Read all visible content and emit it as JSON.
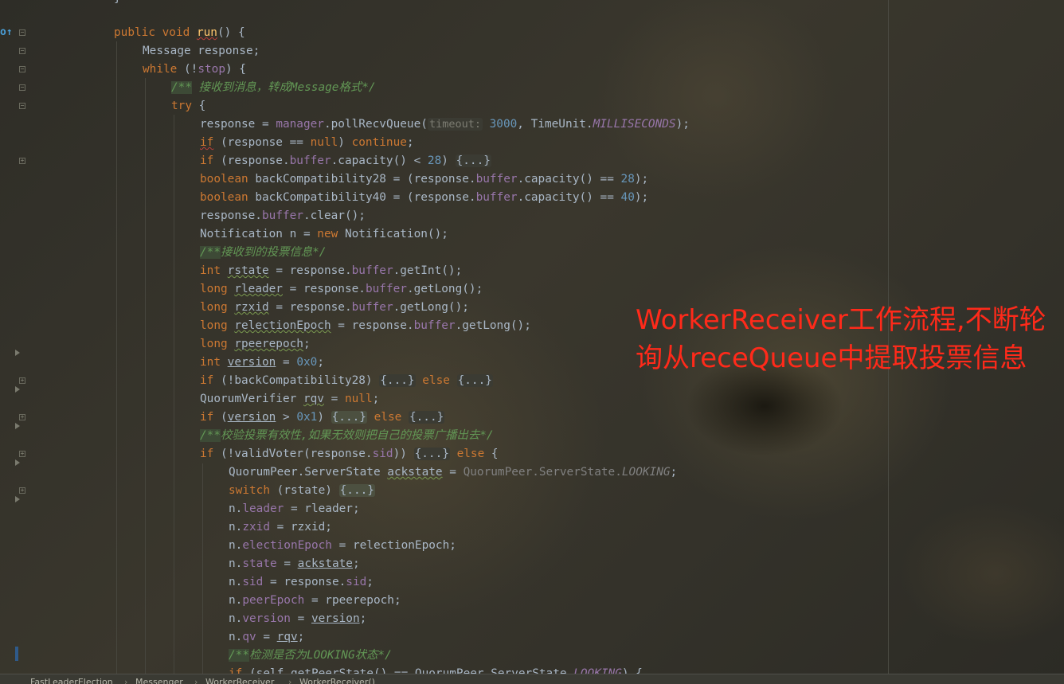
{
  "code": {
    "top_fragment": "}",
    "lines": {
      "l1": {
        "p1": "public void ",
        "p2": "run",
        "p3": "() {"
      },
      "l2": {
        "p1": "Message response;"
      },
      "l3": {
        "p1": "while",
        "p2": " (!",
        "p3": "stop",
        "p4": ") {"
      },
      "l4": {
        "p1": "/**",
        "p2": " 接收到消息，转成Message格式*/"
      },
      "l5": {
        "p1": "try",
        "p2": " {"
      },
      "l6": {
        "p1": "response = ",
        "p2": "manager",
        "p3": ".pollRecvQueue(",
        "hint": "timeout:",
        "p4": " 3000",
        "p5": ", TimeUnit.",
        "p6": "MILLISECONDS",
        "p7": ");"
      },
      "l7": {
        "p1": "if",
        "p2": " (response == ",
        "p3": "null",
        "p4": ") ",
        "p5": "continue",
        "p6": ";"
      },
      "l8": {
        "p1": "if",
        "p2": " (response.",
        "p3": "buffer",
        "p4": ".capacity() < ",
        "p5": "28",
        "p6": ") ",
        "fold": "{...}"
      },
      "l9": {
        "p1": "boolean",
        "p2": " backCompatibility28 = (response.",
        "p3": "buffer",
        "p4": ".capacity() == ",
        "p5": "28",
        "p6": ");"
      },
      "l10": {
        "p1": "boolean",
        "p2": " backCompatibility40 = (response.",
        "p3": "buffer",
        "p4": ".capacity() == ",
        "p5": "40",
        "p6": ");"
      },
      "l11": {
        "p1": "response.",
        "p2": "buffer",
        "p3": ".clear();"
      },
      "l12": {
        "p1": "Notification n = ",
        "p2": "new",
        "p3": " Notification();"
      },
      "l13": {
        "p1": "/**",
        "p2": "接收到的投票信息*/"
      },
      "l14": {
        "p1": "int",
        "p2": " ",
        "p3": "rstate",
        "p4": " = response.",
        "p5": "buffer",
        "p6": ".getInt();"
      },
      "l15": {
        "p1": "long",
        "p2": " ",
        "p3": "rleader",
        "p4": " = response.",
        "p5": "buffer",
        "p6": ".getLong();"
      },
      "l16": {
        "p1": "long",
        "p2": " ",
        "p3": "rzxid",
        "p4": " = response.",
        "p5": "buffer",
        "p6": ".getLong();"
      },
      "l17": {
        "p1": "long",
        "p2": " ",
        "p3": "relectionEpoch",
        "p4": " = response.",
        "p5": "buffer",
        "p6": ".getLong();"
      },
      "l18": {
        "p1": "long",
        "p2": " ",
        "p3": "rpeerepoch",
        "p4": ";"
      },
      "l19": {
        "p1": "int",
        "p2": " ",
        "p3": "version",
        "p4": " = ",
        "p5": "0x0",
        "p6": ";"
      },
      "l20": {
        "p1": "if",
        "p2": " (!backCompatibility28) ",
        "fold1": "{...}",
        "p3": " else ",
        "fold2": "{...}"
      },
      "l21": {
        "p1": "QuorumVerifier ",
        "p2": "rqv",
        "p3": " = ",
        "p4": "null",
        "p5": ";"
      },
      "l22": {
        "p1": "if",
        "p2": " (",
        "p3": "version",
        "p4": " > ",
        "p5": "0x1",
        "p6": ") ",
        "fold1": "{...}",
        "p7": " else ",
        "fold2": "{...}"
      },
      "l23": {
        "p1": "/**",
        "p2": "校验投票有效性,如果无效则把自己的投票广播出去*/"
      },
      "l24": {
        "p1": "if",
        "p2": " (!validVoter(response.",
        "p3": "sid",
        "p4": ")) ",
        "fold": "{...}",
        "p5": " else",
        "p6": " {"
      },
      "l25": {
        "p1": "QuorumPeer.ServerState ",
        "p2": "ackstate",
        "p3": " = ",
        "p4": "QuorumPeer.ServerState.",
        "p5": "LOOKING",
        "p6": ";"
      },
      "l26": {
        "p1": "switch",
        "p2": " (rstate) ",
        "fold": "{...}"
      },
      "l27": {
        "p1": "n.",
        "p2": "leader",
        "p3": " = rleader;"
      },
      "l28": {
        "p1": "n.",
        "p2": "zxid",
        "p3": " = rzxid;"
      },
      "l29": {
        "p1": "n.",
        "p2": "electionEpoch",
        "p3": " = relectionEpoch;"
      },
      "l30": {
        "p1": "n.",
        "p2": "state",
        "p3": " = ",
        "p4": "ackstate",
        "p5": ";"
      },
      "l31": {
        "p1": "n.",
        "p2": "sid",
        "p3": " = response.",
        "p4": "sid",
        "p5": ";"
      },
      "l32": {
        "p1": "n.",
        "p2": "peerEpoch",
        "p3": " = rpeerepoch;"
      },
      "l33": {
        "p1": "n.",
        "p2": "version",
        "p3": " = ",
        "p4": "version",
        "p5": ";"
      },
      "l34": {
        "p1": "n.",
        "p2": "qv",
        "p3": " = ",
        "p4": "rqv",
        "p5": ";"
      },
      "l35": {
        "p1": "/**",
        "p2": "检测是否为",
        "p3": "LOOKING",
        "p4": "状态*/"
      },
      "l36": {
        "p1": "if",
        "p2": " (self.getPeerState() == QuorumPeer.ServerState.",
        "p3": "LOOKING",
        "p4": ") {"
      }
    }
  },
  "annotation": {
    "line1": "WorkerReceiver工作流程,不断轮",
    "line2": "询从receQueue中提取投票信息"
  },
  "breadcrumb": [
    "FastLeaderElection",
    "Messenger",
    "WorkerReceiver",
    "WorkerReceiver()"
  ],
  "colors": {
    "keyword": "#cc7832",
    "method": "#ffc66d",
    "field": "#9876aa",
    "number": "#6897bb",
    "comment": "#629755",
    "text": "#a9b7c6",
    "annotation": "#ff2a1a"
  }
}
